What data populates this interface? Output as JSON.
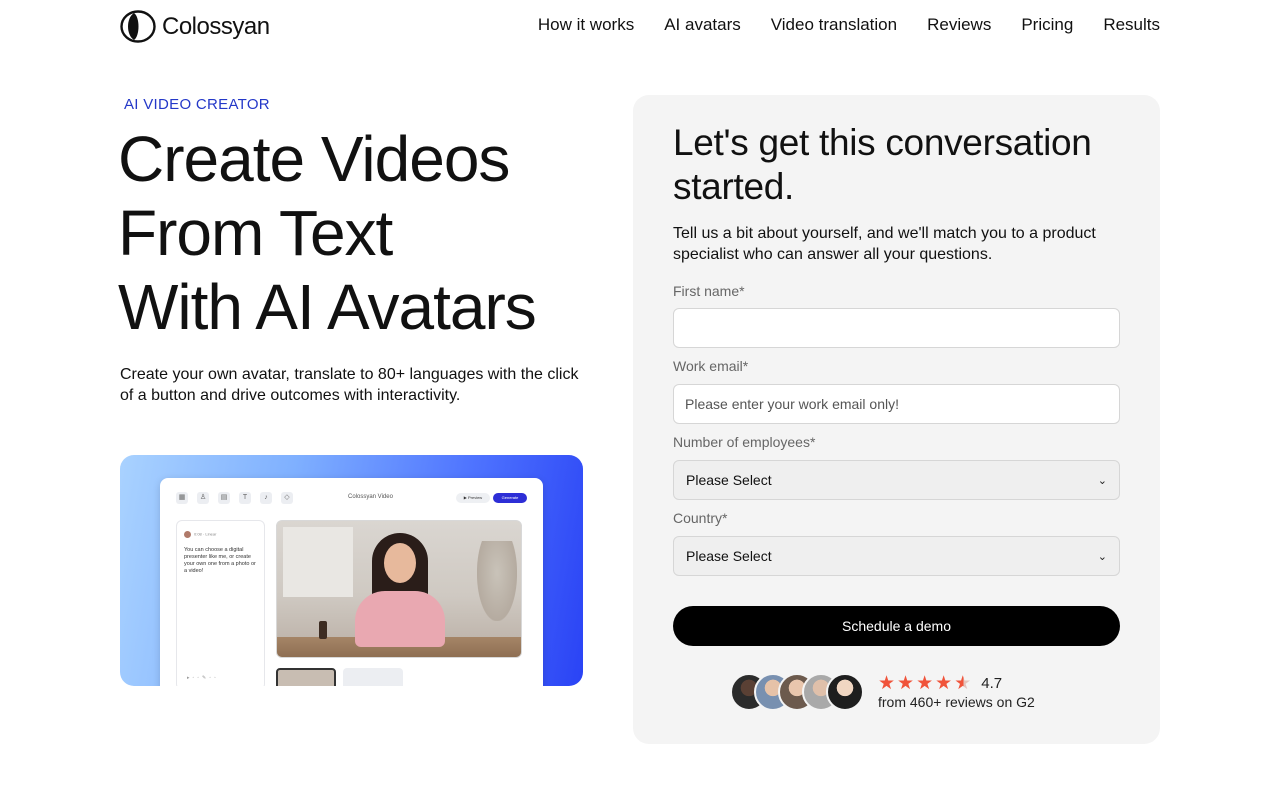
{
  "header": {
    "logo_text": "Colossyan",
    "nav": [
      "How it works",
      "AI avatars",
      "Video translation",
      "Reviews",
      "Pricing",
      "Results"
    ]
  },
  "hero": {
    "eyebrow": "AI VIDEO CREATOR",
    "title_lines": [
      "Create Videos",
      "From Text",
      "With AI Avatars"
    ],
    "subtitle": "Create your own avatar, translate to 80+ languages with the click of a button and drive outcomes with interactivity.",
    "app": {
      "title": "Colossyan Video",
      "preview_label": "▶ Preview",
      "generate_label": "Generate",
      "script_head": "0:08 · Linear",
      "script_text": "You can choose a digital presenter like me, or create your own one from a photo or a video!"
    }
  },
  "form": {
    "title": "Let's get this conversation started.",
    "description": "Tell us a bit about yourself, and we'll match you to a product specialist who can answer all your questions.",
    "first_name_label": "First name*",
    "first_name_value": "",
    "email_label": "Work email*",
    "email_placeholder": "Please enter your work email only!",
    "employees_label": "Number of employees*",
    "employees_value": "Please Select",
    "country_label": "Country*",
    "country_value": "Please Select",
    "submit_label": "Schedule a demo"
  },
  "reviews": {
    "stars": 4.5,
    "score": "4.7",
    "caption": "from 460+ reviews on G2",
    "star_color": "#f0533a"
  },
  "colors": {
    "accent_blue": "#2438c8",
    "card_bg": "#f4f4f4",
    "button_bg": "#000000"
  }
}
